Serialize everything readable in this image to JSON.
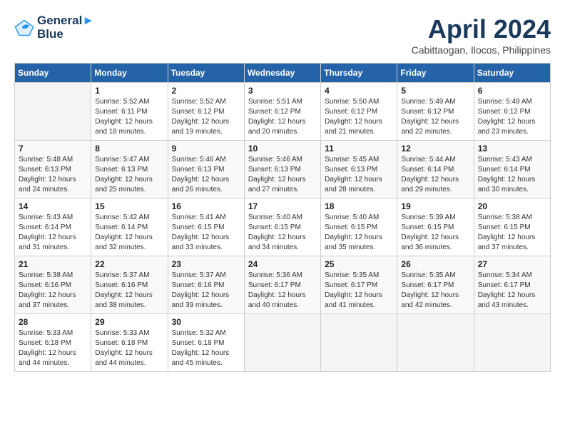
{
  "header": {
    "logo_line1": "General",
    "logo_line2": "Blue",
    "title": "April 2024",
    "subtitle": "Cabittaogan, Ilocos, Philippines"
  },
  "weekdays": [
    "Sunday",
    "Monday",
    "Tuesday",
    "Wednesday",
    "Thursday",
    "Friday",
    "Saturday"
  ],
  "weeks": [
    [
      {
        "day": "",
        "sunrise": "",
        "sunset": "",
        "daylight": ""
      },
      {
        "day": "1",
        "sunrise": "Sunrise: 5:52 AM",
        "sunset": "Sunset: 6:11 PM",
        "daylight": "Daylight: 12 hours and 18 minutes."
      },
      {
        "day": "2",
        "sunrise": "Sunrise: 5:52 AM",
        "sunset": "Sunset: 6:12 PM",
        "daylight": "Daylight: 12 hours and 19 minutes."
      },
      {
        "day": "3",
        "sunrise": "Sunrise: 5:51 AM",
        "sunset": "Sunset: 6:12 PM",
        "daylight": "Daylight: 12 hours and 20 minutes."
      },
      {
        "day": "4",
        "sunrise": "Sunrise: 5:50 AM",
        "sunset": "Sunset: 6:12 PM",
        "daylight": "Daylight: 12 hours and 21 minutes."
      },
      {
        "day": "5",
        "sunrise": "Sunrise: 5:49 AM",
        "sunset": "Sunset: 6:12 PM",
        "daylight": "Daylight: 12 hours and 22 minutes."
      },
      {
        "day": "6",
        "sunrise": "Sunrise: 5:49 AM",
        "sunset": "Sunset: 6:12 PM",
        "daylight": "Daylight: 12 hours and 23 minutes."
      }
    ],
    [
      {
        "day": "7",
        "sunrise": "Sunrise: 5:48 AM",
        "sunset": "Sunset: 6:13 PM",
        "daylight": "Daylight: 12 hours and 24 minutes."
      },
      {
        "day": "8",
        "sunrise": "Sunrise: 5:47 AM",
        "sunset": "Sunset: 6:13 PM",
        "daylight": "Daylight: 12 hours and 25 minutes."
      },
      {
        "day": "9",
        "sunrise": "Sunrise: 5:46 AM",
        "sunset": "Sunset: 6:13 PM",
        "daylight": "Daylight: 12 hours and 26 minutes."
      },
      {
        "day": "10",
        "sunrise": "Sunrise: 5:46 AM",
        "sunset": "Sunset: 6:13 PM",
        "daylight": "Daylight: 12 hours and 27 minutes."
      },
      {
        "day": "11",
        "sunrise": "Sunrise: 5:45 AM",
        "sunset": "Sunset: 6:13 PM",
        "daylight": "Daylight: 12 hours and 28 minutes."
      },
      {
        "day": "12",
        "sunrise": "Sunrise: 5:44 AM",
        "sunset": "Sunset: 6:14 PM",
        "daylight": "Daylight: 12 hours and 29 minutes."
      },
      {
        "day": "13",
        "sunrise": "Sunrise: 5:43 AM",
        "sunset": "Sunset: 6:14 PM",
        "daylight": "Daylight: 12 hours and 30 minutes."
      }
    ],
    [
      {
        "day": "14",
        "sunrise": "Sunrise: 5:43 AM",
        "sunset": "Sunset: 6:14 PM",
        "daylight": "Daylight: 12 hours and 31 minutes."
      },
      {
        "day": "15",
        "sunrise": "Sunrise: 5:42 AM",
        "sunset": "Sunset: 6:14 PM",
        "daylight": "Daylight: 12 hours and 32 minutes."
      },
      {
        "day": "16",
        "sunrise": "Sunrise: 5:41 AM",
        "sunset": "Sunset: 6:15 PM",
        "daylight": "Daylight: 12 hours and 33 minutes."
      },
      {
        "day": "17",
        "sunrise": "Sunrise: 5:40 AM",
        "sunset": "Sunset: 6:15 PM",
        "daylight": "Daylight: 12 hours and 34 minutes."
      },
      {
        "day": "18",
        "sunrise": "Sunrise: 5:40 AM",
        "sunset": "Sunset: 6:15 PM",
        "daylight": "Daylight: 12 hours and 35 minutes."
      },
      {
        "day": "19",
        "sunrise": "Sunrise: 5:39 AM",
        "sunset": "Sunset: 6:15 PM",
        "daylight": "Daylight: 12 hours and 36 minutes."
      },
      {
        "day": "20",
        "sunrise": "Sunrise: 5:38 AM",
        "sunset": "Sunset: 6:15 PM",
        "daylight": "Daylight: 12 hours and 37 minutes."
      }
    ],
    [
      {
        "day": "21",
        "sunrise": "Sunrise: 5:38 AM",
        "sunset": "Sunset: 6:16 PM",
        "daylight": "Daylight: 12 hours and 37 minutes."
      },
      {
        "day": "22",
        "sunrise": "Sunrise: 5:37 AM",
        "sunset": "Sunset: 6:16 PM",
        "daylight": "Daylight: 12 hours and 38 minutes."
      },
      {
        "day": "23",
        "sunrise": "Sunrise: 5:37 AM",
        "sunset": "Sunset: 6:16 PM",
        "daylight": "Daylight: 12 hours and 39 minutes."
      },
      {
        "day": "24",
        "sunrise": "Sunrise: 5:36 AM",
        "sunset": "Sunset: 6:17 PM",
        "daylight": "Daylight: 12 hours and 40 minutes."
      },
      {
        "day": "25",
        "sunrise": "Sunrise: 5:35 AM",
        "sunset": "Sunset: 6:17 PM",
        "daylight": "Daylight: 12 hours and 41 minutes."
      },
      {
        "day": "26",
        "sunrise": "Sunrise: 5:35 AM",
        "sunset": "Sunset: 6:17 PM",
        "daylight": "Daylight: 12 hours and 42 minutes."
      },
      {
        "day": "27",
        "sunrise": "Sunrise: 5:34 AM",
        "sunset": "Sunset: 6:17 PM",
        "daylight": "Daylight: 12 hours and 43 minutes."
      }
    ],
    [
      {
        "day": "28",
        "sunrise": "Sunrise: 5:33 AM",
        "sunset": "Sunset: 6:18 PM",
        "daylight": "Daylight: 12 hours and 44 minutes."
      },
      {
        "day": "29",
        "sunrise": "Sunrise: 5:33 AM",
        "sunset": "Sunset: 6:18 PM",
        "daylight": "Daylight: 12 hours and 44 minutes."
      },
      {
        "day": "30",
        "sunrise": "Sunrise: 5:32 AM",
        "sunset": "Sunset: 6:18 PM",
        "daylight": "Daylight: 12 hours and 45 minutes."
      },
      {
        "day": "",
        "sunrise": "",
        "sunset": "",
        "daylight": ""
      },
      {
        "day": "",
        "sunrise": "",
        "sunset": "",
        "daylight": ""
      },
      {
        "day": "",
        "sunrise": "",
        "sunset": "",
        "daylight": ""
      },
      {
        "day": "",
        "sunrise": "",
        "sunset": "",
        "daylight": ""
      }
    ]
  ]
}
